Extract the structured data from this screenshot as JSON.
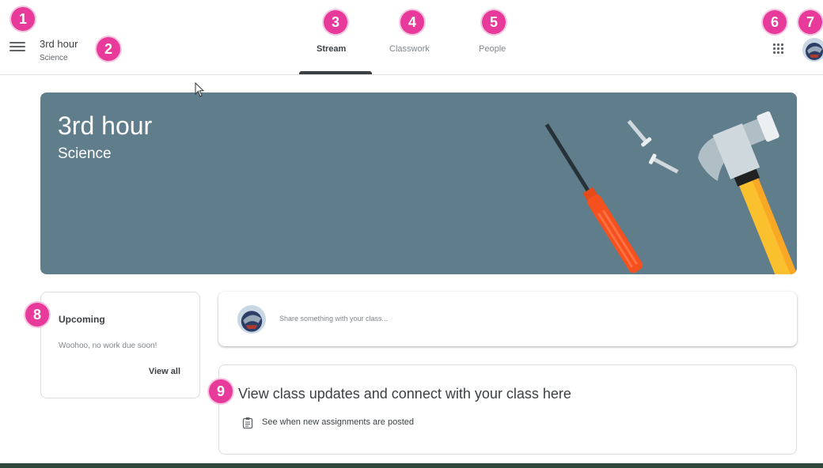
{
  "header": {
    "class_name": "3rd hour",
    "class_subject": "Science",
    "tabs": [
      {
        "label": "Stream",
        "active": true
      },
      {
        "label": "Classwork",
        "active": false
      },
      {
        "label": "People",
        "active": false
      }
    ]
  },
  "banner": {
    "title": "3rd hour",
    "subtitle": "Science",
    "color": "#607d8b",
    "illustration": "tools-screwdriver-hammer-screws"
  },
  "upcoming": {
    "title": "Upcoming",
    "message": "Woohoo, no work due soon!",
    "link_label": "View all"
  },
  "share": {
    "placeholder": "Share something with your class..."
  },
  "updates": {
    "title": "View class updates and connect with your class here",
    "item_label": "See when new assignments are posted",
    "item_icon": "assignment-icon"
  },
  "callouts": [
    "1",
    "2",
    "3",
    "4",
    "5",
    "6",
    "7",
    "8",
    "9"
  ],
  "colors": {
    "callout": "#e83a9b",
    "accent_text": "#3c4043",
    "border": "#dadce0"
  }
}
